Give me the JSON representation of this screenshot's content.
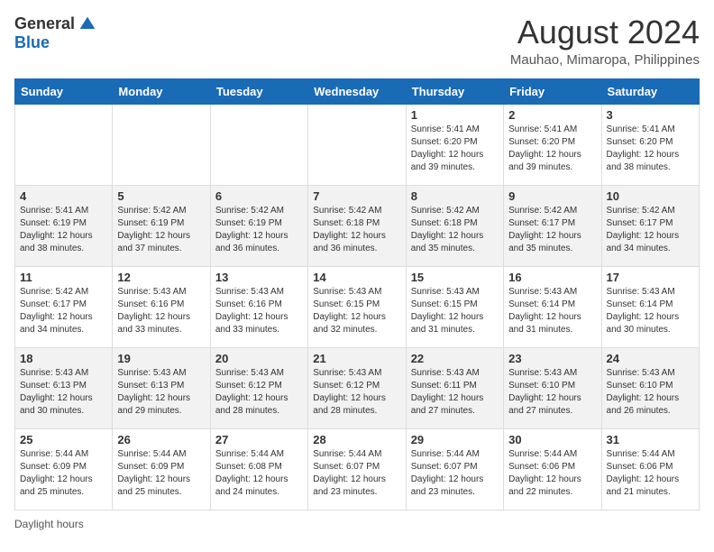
{
  "header": {
    "logo_general": "General",
    "logo_blue": "Blue",
    "month_title": "August 2024",
    "location": "Mauhao, Mimaropa, Philippines"
  },
  "days_of_week": [
    "Sunday",
    "Monday",
    "Tuesday",
    "Wednesday",
    "Thursday",
    "Friday",
    "Saturday"
  ],
  "weeks": [
    [
      {
        "day": "",
        "info": ""
      },
      {
        "day": "",
        "info": ""
      },
      {
        "day": "",
        "info": ""
      },
      {
        "day": "",
        "info": ""
      },
      {
        "day": "1",
        "info": "Sunrise: 5:41 AM\nSunset: 6:20 PM\nDaylight: 12 hours\nand 39 minutes."
      },
      {
        "day": "2",
        "info": "Sunrise: 5:41 AM\nSunset: 6:20 PM\nDaylight: 12 hours\nand 39 minutes."
      },
      {
        "day": "3",
        "info": "Sunrise: 5:41 AM\nSunset: 6:20 PM\nDaylight: 12 hours\nand 38 minutes."
      }
    ],
    [
      {
        "day": "4",
        "info": "Sunrise: 5:41 AM\nSunset: 6:19 PM\nDaylight: 12 hours\nand 38 minutes."
      },
      {
        "day": "5",
        "info": "Sunrise: 5:42 AM\nSunset: 6:19 PM\nDaylight: 12 hours\nand 37 minutes."
      },
      {
        "day": "6",
        "info": "Sunrise: 5:42 AM\nSunset: 6:19 PM\nDaylight: 12 hours\nand 36 minutes."
      },
      {
        "day": "7",
        "info": "Sunrise: 5:42 AM\nSunset: 6:18 PM\nDaylight: 12 hours\nand 36 minutes."
      },
      {
        "day": "8",
        "info": "Sunrise: 5:42 AM\nSunset: 6:18 PM\nDaylight: 12 hours\nand 35 minutes."
      },
      {
        "day": "9",
        "info": "Sunrise: 5:42 AM\nSunset: 6:17 PM\nDaylight: 12 hours\nand 35 minutes."
      },
      {
        "day": "10",
        "info": "Sunrise: 5:42 AM\nSunset: 6:17 PM\nDaylight: 12 hours\nand 34 minutes."
      }
    ],
    [
      {
        "day": "11",
        "info": "Sunrise: 5:42 AM\nSunset: 6:17 PM\nDaylight: 12 hours\nand 34 minutes."
      },
      {
        "day": "12",
        "info": "Sunrise: 5:43 AM\nSunset: 6:16 PM\nDaylight: 12 hours\nand 33 minutes."
      },
      {
        "day": "13",
        "info": "Sunrise: 5:43 AM\nSunset: 6:16 PM\nDaylight: 12 hours\nand 33 minutes."
      },
      {
        "day": "14",
        "info": "Sunrise: 5:43 AM\nSunset: 6:15 PM\nDaylight: 12 hours\nand 32 minutes."
      },
      {
        "day": "15",
        "info": "Sunrise: 5:43 AM\nSunset: 6:15 PM\nDaylight: 12 hours\nand 31 minutes."
      },
      {
        "day": "16",
        "info": "Sunrise: 5:43 AM\nSunset: 6:14 PM\nDaylight: 12 hours\nand 31 minutes."
      },
      {
        "day": "17",
        "info": "Sunrise: 5:43 AM\nSunset: 6:14 PM\nDaylight: 12 hours\nand 30 minutes."
      }
    ],
    [
      {
        "day": "18",
        "info": "Sunrise: 5:43 AM\nSunset: 6:13 PM\nDaylight: 12 hours\nand 30 minutes."
      },
      {
        "day": "19",
        "info": "Sunrise: 5:43 AM\nSunset: 6:13 PM\nDaylight: 12 hours\nand 29 minutes."
      },
      {
        "day": "20",
        "info": "Sunrise: 5:43 AM\nSunset: 6:12 PM\nDaylight: 12 hours\nand 28 minutes."
      },
      {
        "day": "21",
        "info": "Sunrise: 5:43 AM\nSunset: 6:12 PM\nDaylight: 12 hours\nand 28 minutes."
      },
      {
        "day": "22",
        "info": "Sunrise: 5:43 AM\nSunset: 6:11 PM\nDaylight: 12 hours\nand 27 minutes."
      },
      {
        "day": "23",
        "info": "Sunrise: 5:43 AM\nSunset: 6:10 PM\nDaylight: 12 hours\nand 27 minutes."
      },
      {
        "day": "24",
        "info": "Sunrise: 5:43 AM\nSunset: 6:10 PM\nDaylight: 12 hours\nand 26 minutes."
      }
    ],
    [
      {
        "day": "25",
        "info": "Sunrise: 5:44 AM\nSunset: 6:09 PM\nDaylight: 12 hours\nand 25 minutes."
      },
      {
        "day": "26",
        "info": "Sunrise: 5:44 AM\nSunset: 6:09 PM\nDaylight: 12 hours\nand 25 minutes."
      },
      {
        "day": "27",
        "info": "Sunrise: 5:44 AM\nSunset: 6:08 PM\nDaylight: 12 hours\nand 24 minutes."
      },
      {
        "day": "28",
        "info": "Sunrise: 5:44 AM\nSunset: 6:07 PM\nDaylight: 12 hours\nand 23 minutes."
      },
      {
        "day": "29",
        "info": "Sunrise: 5:44 AM\nSunset: 6:07 PM\nDaylight: 12 hours\nand 23 minutes."
      },
      {
        "day": "30",
        "info": "Sunrise: 5:44 AM\nSunset: 6:06 PM\nDaylight: 12 hours\nand 22 minutes."
      },
      {
        "day": "31",
        "info": "Sunrise: 5:44 AM\nSunset: 6:06 PM\nDaylight: 12 hours\nand 21 minutes."
      }
    ]
  ],
  "footer": {
    "note": "Daylight hours"
  }
}
